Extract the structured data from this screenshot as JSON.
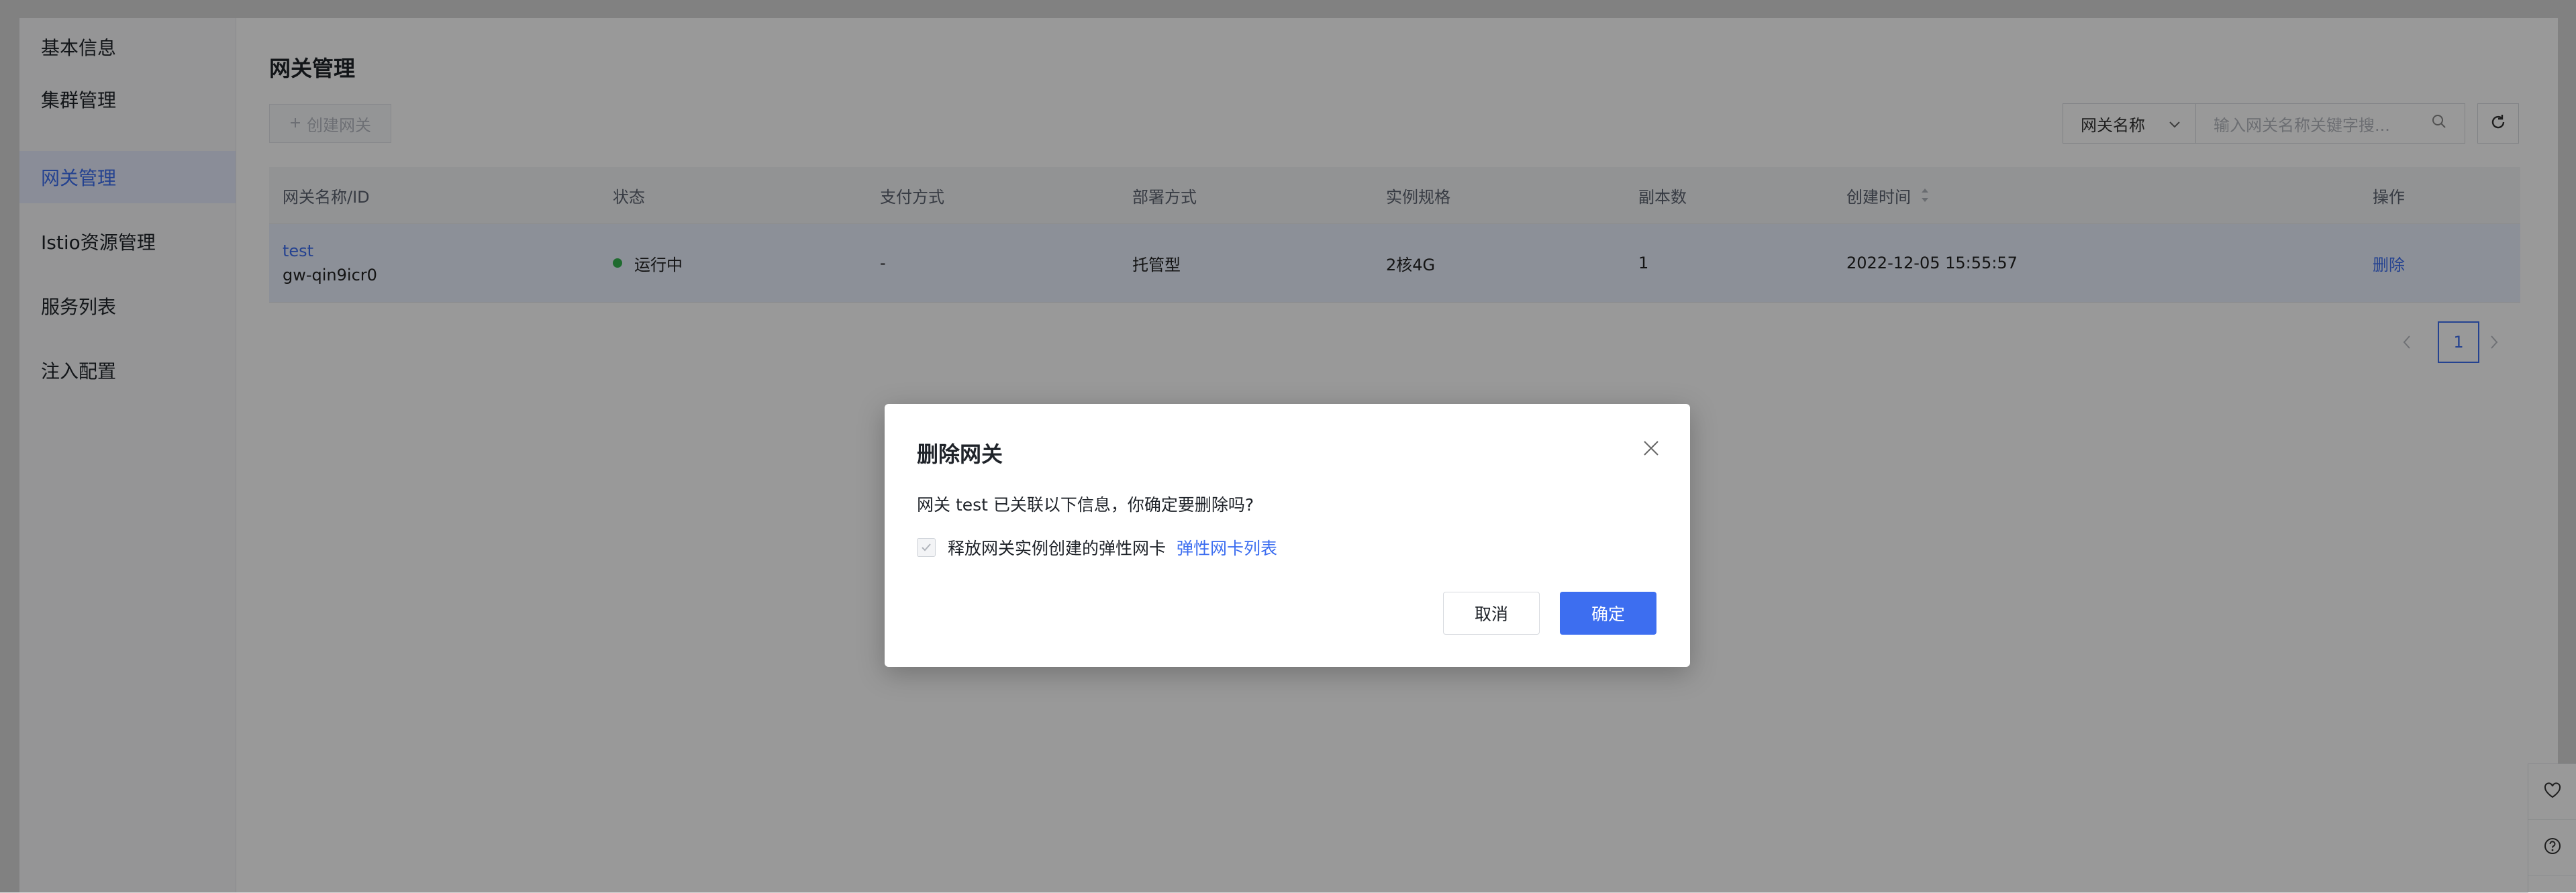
{
  "sidebar": {
    "items": [
      {
        "label": "基本信息"
      },
      {
        "label": "集群管理"
      },
      {
        "label": "网关管理",
        "active": true
      },
      {
        "label": "Istio资源管理"
      },
      {
        "label": "服务列表"
      },
      {
        "label": "注入配置"
      }
    ]
  },
  "page": {
    "title": "网关管理",
    "create_button": "创建网关",
    "filter": {
      "select_value": "网关名称",
      "placeholder": "输入网关名称关键字搜..."
    }
  },
  "table": {
    "headers": [
      "网关名称/ID",
      "状态",
      "支付方式",
      "部署方式",
      "实例规格",
      "副本数",
      "创建时间",
      "操作"
    ],
    "rows": [
      {
        "name": "test",
        "id": "gw-qin9icr0",
        "status": "运行中",
        "payment": "-",
        "deploy": "托管型",
        "spec": "2核4G",
        "replicas": "1",
        "created": "2022-12-05 15:55:57",
        "action": "删除"
      }
    ]
  },
  "pagination": {
    "current": "1"
  },
  "modal": {
    "title": "删除网关",
    "message": "网关 test 已关联以下信息，你确定要删除吗?",
    "checkbox_label": "释放网关实例创建的弹性网卡",
    "link": "弹性网卡列表",
    "cancel": "取消",
    "confirm": "确定"
  },
  "colors": {
    "primary": "#3d6ef0",
    "status_running": "#34b24f",
    "overlay": "rgba(0,0,0,0.40)"
  },
  "icons": [
    "plus-icon",
    "chevron-down-icon",
    "search-icon",
    "refresh-icon",
    "sort-icon",
    "chevron-left-icon",
    "chevron-right-icon",
    "heart-icon",
    "help-icon",
    "close-icon",
    "check-icon"
  ]
}
